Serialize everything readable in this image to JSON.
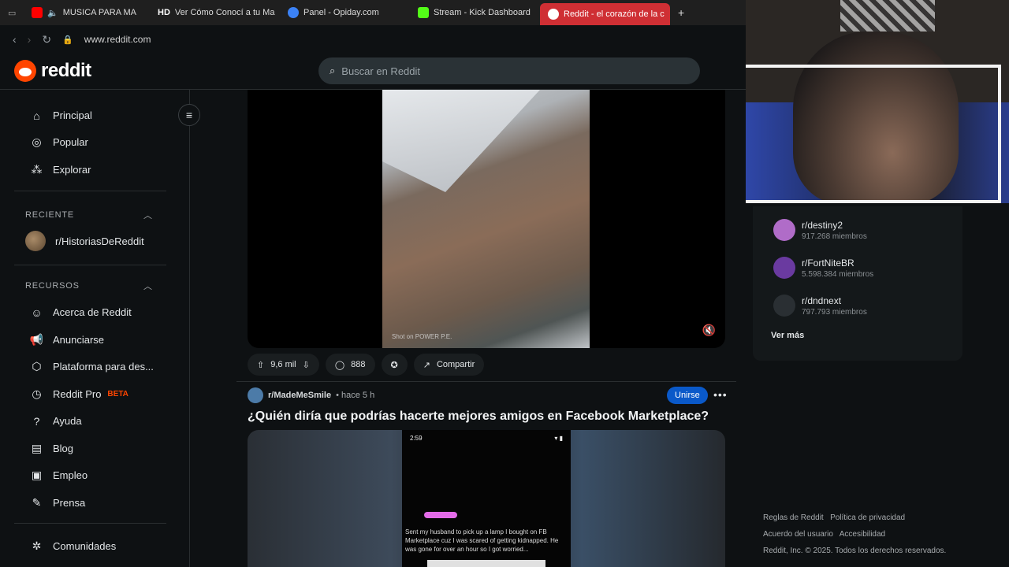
{
  "browser": {
    "tabs": [
      {
        "label": "MUSICA PARA MA",
        "icon_color": "#ff0000",
        "active": false
      },
      {
        "label": "Ver Cómo Conocí a tu Ma",
        "icon_text": "HD",
        "active": false
      },
      {
        "label": "Panel - Opiday.com",
        "icon_color": "#3b82f6",
        "active": false
      },
      {
        "label": "Stream - Kick Dashboard",
        "icon_color": "#53fc18",
        "active": false
      },
      {
        "label": "Reddit - el corazón de la c",
        "icon_color": "#ff4500",
        "active": true
      }
    ],
    "new_tab_symbol": "+",
    "url": "www.reddit.com"
  },
  "header": {
    "logo_text": "reddit",
    "search_placeholder": "Buscar en Reddit"
  },
  "sidebar": {
    "main_items": [
      {
        "label": "Principal",
        "icon": "home-icon"
      },
      {
        "label": "Popular",
        "icon": "popular-icon"
      },
      {
        "label": "Explorar",
        "icon": "explore-icon"
      }
    ],
    "recent_heading": "RECIENTE",
    "recent_items": [
      {
        "label": "r/HistoriasDeReddit"
      }
    ],
    "resources_heading": "RECURSOS",
    "resource_items": [
      {
        "label": "Acerca de Reddit",
        "icon": "reddit-alien-icon"
      },
      {
        "label": "Anunciarse",
        "icon": "megaphone-icon"
      },
      {
        "label": "Plataforma para des...",
        "icon": "developer-icon"
      },
      {
        "label": "Reddit Pro",
        "icon": "reddit-pro-icon",
        "badge": "BETA"
      },
      {
        "label": "Ayuda",
        "icon": "help-icon"
      },
      {
        "label": "Blog",
        "icon": "blog-icon"
      },
      {
        "label": "Empleo",
        "icon": "briefcase-icon"
      },
      {
        "label": "Prensa",
        "icon": "press-icon"
      }
    ],
    "communities_label": "Comunidades"
  },
  "post1": {
    "video_caption": "Shot on POWER P.E.",
    "upvotes": "9,6 mil",
    "comments": "888",
    "share_label": "Compartir"
  },
  "post2": {
    "subreddit": "r/MadeMeSmile",
    "time": "hace 5 h",
    "join_label": "Unirse",
    "title": "¿Quién diría que podrías hacerte mejores amigos en Facebook Marketplace?",
    "phone_time": "2:59",
    "phone_text": "Sent my husband to pick up a lamp I bought on FB Marketplace cuz I was scared of getting kidnapped. He was gone for over an hour so I got worried..."
  },
  "right": {
    "communities": [
      {
        "name": "r/destiny2",
        "members": "917.268 miembros",
        "color": "#b06cc8"
      },
      {
        "name": "r/FortNiteBR",
        "members": "5.598.384 miembros",
        "color": "#6a3aa0"
      },
      {
        "name": "r/dndnext",
        "members": "797.793 miembros",
        "color": "#2a2f33"
      }
    ],
    "see_more": "Ver más",
    "footer_line1a": "Reglas de Reddit",
    "footer_line1b": "Política de privacidad",
    "footer_line2a": "Acuerdo del usuario",
    "footer_line2b": "Accesibilidad",
    "footer_line3": "Reddit, Inc. © 2025. Todos los derechos reservados."
  }
}
